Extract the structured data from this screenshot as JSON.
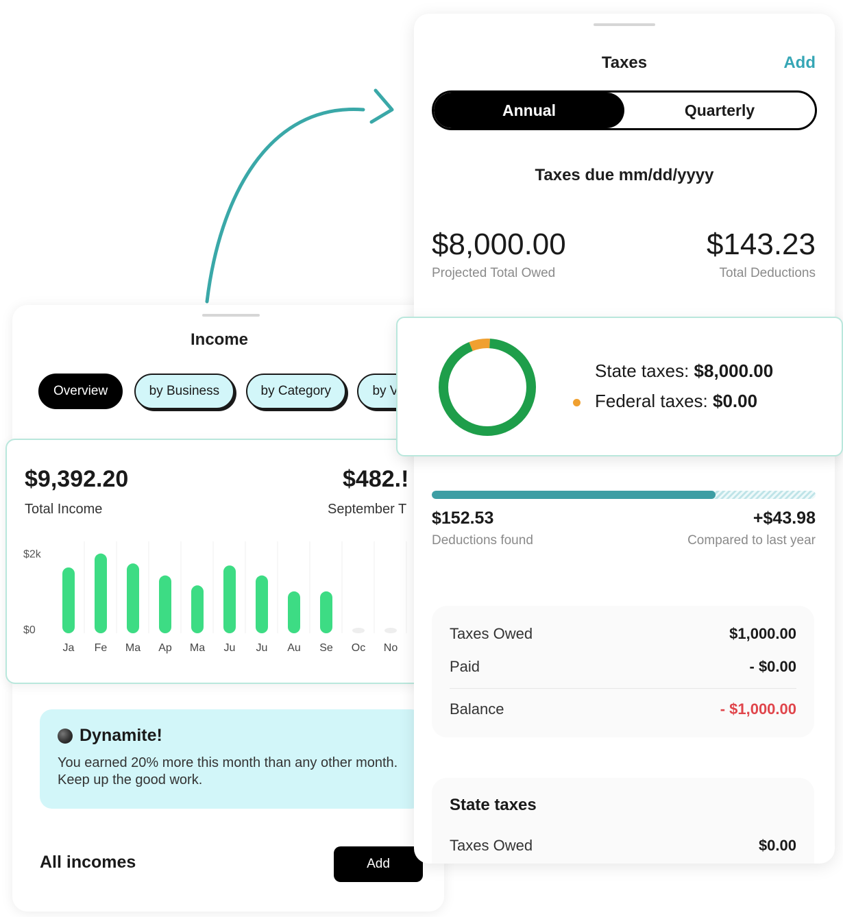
{
  "income": {
    "title": "Income",
    "tabs": [
      "Overview",
      "by Business",
      "by Category",
      "by V"
    ],
    "total_income": "$9,392.20",
    "total_income_label": "Total Income",
    "month_amount": "$482.!",
    "month_label": "September T",
    "dynamite": {
      "title": "Dynamite!",
      "text": "You earned 20% more this month than any other month. Keep up the good work."
    },
    "all_incomes_label": "All incomes",
    "add_label": "Add"
  },
  "chart_data": {
    "type": "bar",
    "categories": [
      "Ja",
      "Fe",
      "Ma",
      "Ap",
      "Ma",
      "Ju",
      "Ju",
      "Au",
      "Se",
      "Oc",
      "No"
    ],
    "values": [
      1.65,
      2.0,
      1.75,
      1.45,
      1.2,
      1.7,
      1.45,
      1.05,
      1.05,
      0,
      0
    ],
    "ytick_labels": [
      "$2k",
      "$0"
    ],
    "ylim": [
      0,
      2.2
    ],
    "bar_color": "#3ddc84",
    "empty_bar_color": "#eeeeee"
  },
  "taxes": {
    "title": "Taxes",
    "add_label": "Add",
    "segments": [
      "Annual",
      "Quarterly"
    ],
    "due_label": "Taxes due mm/dd/yyyy",
    "projected_total": "$8,000.00",
    "projected_label": "Projected Total Owed",
    "total_deductions": "$143.23",
    "deductions_label": "Total Deductions",
    "state_line_label": "State taxes:",
    "state_line_value": "$8,000.00",
    "federal_line_label": "Federal taxes:",
    "federal_line_value": "$0.00",
    "donut": {
      "segments": [
        {
          "label": "State taxes",
          "fraction": 0.93,
          "color": "#1e9e4a"
        },
        {
          "label": "Federal taxes",
          "fraction": 0.07,
          "color": "#f0a030"
        }
      ]
    },
    "deductions_progress": 0.74,
    "deductions_found": "$152.53",
    "deductions_found_label": "Deductions found",
    "compared": "+$43.98",
    "compared_label": "Compared to last year",
    "owed_rows": [
      {
        "label": "Taxes Owed",
        "value": "$1,000.00"
      },
      {
        "label": "Paid",
        "value": "- $0.00"
      },
      {
        "label": "Balance",
        "value": "- $1,000.00"
      }
    ],
    "state_section": {
      "title": "State taxes",
      "row_label": "Taxes Owed",
      "row_value": "$0.00"
    }
  },
  "colors": {
    "accent": "#35a6b5",
    "mint_bg": "#d2f6f9",
    "balance_red": "#e0454b"
  }
}
